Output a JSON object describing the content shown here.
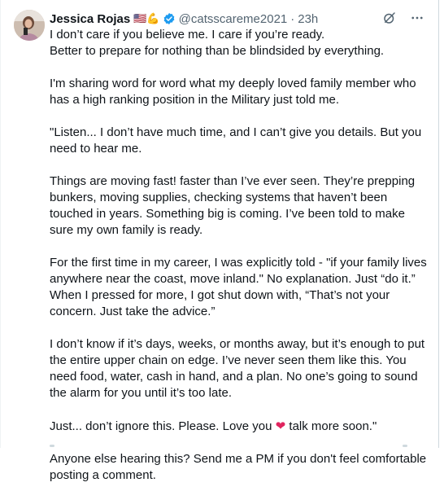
{
  "author": {
    "name": "Jessica Rojas",
    "flags": "🇺🇸💪",
    "handle": "@catsscareme2021",
    "time": "23h"
  },
  "icons": {
    "verified": "verified-badge-icon",
    "grok": "grok-icon",
    "more": "more-icon"
  },
  "colors": {
    "verified": "#1d9bf0",
    "heart": "#e0245e",
    "secondary_text": "#536471"
  },
  "post": {
    "line1": "I don’t care if you believe me. I care if you’re ready.",
    "line2": "Better to prepare for nothing than be blindsided by everything.",
    "p2": "I'm sharing word for word what my deeply loved family member who has a high ranking position in the Military just told me.",
    "p3": "\"Listen... I don’t have much time, and I can’t give you details. But you need to hear me.",
    "p4": "Things are moving fast!  faster than I’ve ever seen. They’re prepping bunkers, moving supplies, checking systems that haven’t been touched in years. Something big is coming. I’ve been told to make sure my own family is ready.",
    "p5": "For the first time in my career, I was explicitly told - \"if your family lives anywhere near the coast, move inland.\"  No explanation. Just “do it.” When I pressed for more, I got shut down with, “That’s not your concern. Just take the advice.”",
    "p6": "I don’t know if it’s days, weeks, or months away, but it’s enough to put the entire upper chain on edge. I’ve never seen them like this. You need food, water, cash in hand, and a plan. No one’s going to sound the alarm for you until it’s too late.",
    "p7a": "Just... don’t ignore this. Please. Love you ",
    "heart": "❤",
    "p7b": " talk more soon.\"",
    "p8": "Anyone else hearing this? Send me a PM if you don't feel comfortable posting a comment."
  }
}
